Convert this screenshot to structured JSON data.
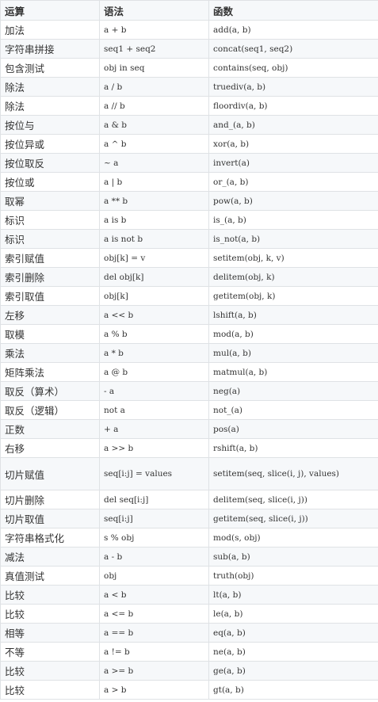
{
  "header": {
    "operation": "运算",
    "syntax": "语法",
    "function": "函数"
  },
  "rows": [
    {
      "op": "加法",
      "syntax": "a + b",
      "fn": "add(a, b)"
    },
    {
      "op": "字符串拼接",
      "syntax": "seq1 + seq2",
      "fn": "concat(seq1, seq2)"
    },
    {
      "op": "包含测试",
      "syntax": "obj in seq",
      "fn": "contains(seq, obj)"
    },
    {
      "op": "除法",
      "syntax": "a / b",
      "fn": "truediv(a, b)"
    },
    {
      "op": "除法",
      "syntax": "a // b",
      "fn": "floordiv(a, b)"
    },
    {
      "op": "按位与",
      "syntax": "a & b",
      "fn": "and_(a, b)"
    },
    {
      "op": "按位异或",
      "syntax": "a ^ b",
      "fn": "xor(a, b)"
    },
    {
      "op": "按位取反",
      "syntax": "~ a",
      "fn": "invert(a)"
    },
    {
      "op": "按位或",
      "syntax": "a | b",
      "fn": "or_(a, b)"
    },
    {
      "op": "取幂",
      "syntax": "a ** b",
      "fn": "pow(a, b)"
    },
    {
      "op": "标识",
      "syntax": "a is b",
      "fn": "is_(a, b)"
    },
    {
      "op": "标识",
      "syntax": "a is not b",
      "fn": "is_not(a, b)"
    },
    {
      "op": "索引赋值",
      "syntax": "obj[k] = v",
      "fn": "setitem(obj, k, v)"
    },
    {
      "op": "索引删除",
      "syntax": "del obj[k]",
      "fn": "delitem(obj, k)"
    },
    {
      "op": "索引取值",
      "syntax": "obj[k]",
      "fn": "getitem(obj, k)"
    },
    {
      "op": "左移",
      "syntax": "a << b",
      "fn": "lshift(a, b)"
    },
    {
      "op": "取模",
      "syntax": "a % b",
      "fn": "mod(a, b)"
    },
    {
      "op": "乘法",
      "syntax": "a * b",
      "fn": "mul(a, b)"
    },
    {
      "op": "矩阵乘法",
      "syntax": "a @ b",
      "fn": "matmul(a, b)"
    },
    {
      "op": "取反（算术）",
      "syntax": "- a",
      "fn": "neg(a)"
    },
    {
      "op": "取反（逻辑）",
      "syntax": "not a",
      "fn": "not_(a)"
    },
    {
      "op": "正数",
      "syntax": "+ a",
      "fn": "pos(a)"
    },
    {
      "op": "右移",
      "syntax": "a >> b",
      "fn": "rshift(a, b)"
    },
    {
      "op": "切片赋值",
      "syntax": "seq[i:j] = values",
      "fn": "setitem(seq, slice(i, j), values)"
    },
    {
      "op": "切片删除",
      "syntax": "del seq[i:j]",
      "fn": "delitem(seq, slice(i, j))"
    },
    {
      "op": "切片取值",
      "syntax": "seq[i:j]",
      "fn": "getitem(seq, slice(i, j))"
    },
    {
      "op": "字符串格式化",
      "syntax": "s % obj",
      "fn": "mod(s, obj)"
    },
    {
      "op": "减法",
      "syntax": "a - b",
      "fn": "sub(a, b)"
    },
    {
      "op": "真值测试",
      "syntax": "obj",
      "fn": "truth(obj)"
    },
    {
      "op": "比较",
      "syntax": "a < b",
      "fn": "lt(a, b)"
    },
    {
      "op": "比较",
      "syntax": "a <= b",
      "fn": "le(a, b)"
    },
    {
      "op": "相等",
      "syntax": "a == b",
      "fn": "eq(a, b)"
    },
    {
      "op": "不等",
      "syntax": "a != b",
      "fn": "ne(a, b)"
    },
    {
      "op": "比较",
      "syntax": "a >= b",
      "fn": "ge(a, b)"
    },
    {
      "op": "比较",
      "syntax": "a > b",
      "fn": "gt(a, b)"
    }
  ]
}
